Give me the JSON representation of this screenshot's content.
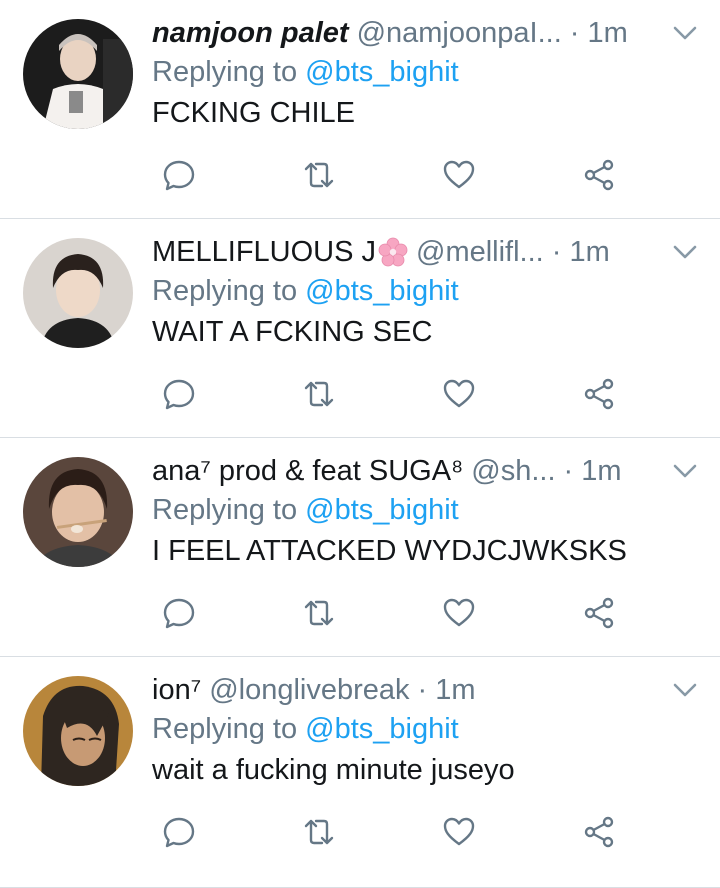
{
  "colors": {
    "name_text": "#14171a",
    "secondary_text": "#657786",
    "link_blue": "#1da1f2",
    "icon_grey": "#657786",
    "divider": "#d9dee3",
    "flower_pink": "#f7a6c2"
  },
  "tweets": [
    {
      "display_name": "namjoon palet",
      "handle": "@namjoonpaI...",
      "time": "· 1m",
      "replying_prefix": "Replying to ",
      "replying_to": "@bts_bighit",
      "text": "FCKING CHILE",
      "avatar": "avatar-photo"
    },
    {
      "display_name": "MELLIFLUOUS J",
      "name_emoji": "cherry-blossom-icon",
      "handle": "@mellifl...",
      "time": "· 1m",
      "replying_prefix": "Replying to ",
      "replying_to": "@bts_bighit",
      "text": "WAIT A FCKING SEC",
      "avatar": "avatar-photo"
    },
    {
      "display_name": "ana⁷ prod & feat SUGA⁸",
      "handle": "@sh...",
      "time": "· 1m",
      "replying_prefix": "Replying to ",
      "replying_to": "@bts_bighit",
      "text": "I FEEL ATTACKED WYDJCJWKSKS",
      "avatar": "avatar-photo"
    },
    {
      "display_name": "ion⁷",
      "handle": "@longlivebreak",
      "time": "· 1m",
      "replying_prefix": "Replying to ",
      "replying_to": "@bts_bighit",
      "text": "wait a fucking minute juseyo",
      "avatar": "avatar-illustration"
    }
  ],
  "icons": {
    "reply": "reply-icon",
    "retweet": "retweet-icon",
    "like": "heart-icon",
    "share": "share-icon",
    "menu": "chevron-down-icon"
  }
}
